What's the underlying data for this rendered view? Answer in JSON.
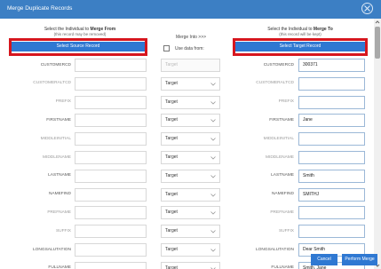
{
  "dialog": {
    "title": "Merge Duplicate Records"
  },
  "left_header": {
    "line1_prefix": "Select the Individual to ",
    "line1_bold": "Merge From",
    "line2": "(this record may be removed)",
    "button": "Select Source Record"
  },
  "middle_header": {
    "merge_into": "Merge Into >>>",
    "use_data_from": "Use data from:"
  },
  "right_header": {
    "line1_prefix": "Select the Individual to ",
    "line1_bold": "Merge To",
    "line2": "(this record will be kept)",
    "button": "Select Target Record"
  },
  "rows": [
    {
      "label": "CUSTOMERCD",
      "choice": "Target",
      "disabled": true,
      "value": "300371"
    },
    {
      "label": "CUSTOMERALTCD",
      "choice": "Target",
      "disabled": false,
      "value": ""
    },
    {
      "label": "PREFIX",
      "choice": "Target",
      "disabled": false,
      "value": ""
    },
    {
      "label": "FIRSTNAME",
      "choice": "Target",
      "disabled": false,
      "value": "Jane"
    },
    {
      "label": "MIDDLEINITIAL",
      "choice": "Target",
      "disabled": false,
      "value": ""
    },
    {
      "label": "MIDDLENAME",
      "choice": "Target",
      "disabled": false,
      "value": ""
    },
    {
      "label": "LASTNAME",
      "choice": "Target",
      "disabled": false,
      "value": "Smith"
    },
    {
      "label": "NAMEFIND",
      "choice": "Target",
      "disabled": false,
      "value": "SMITHJ"
    },
    {
      "label": "PREFNAME",
      "choice": "Target",
      "disabled": false,
      "value": ""
    },
    {
      "label": "SUFFIX",
      "choice": "Target",
      "disabled": false,
      "value": ""
    },
    {
      "label": "LONGSALUTATION",
      "choice": "Target",
      "disabled": false,
      "value": "Dear Smith"
    },
    {
      "label": "FULLNAME",
      "choice": "Target",
      "disabled": false,
      "value": "Smith, Jane"
    }
  ],
  "footer": {
    "cancel": "Cancel",
    "perform_merge": "Perform Merge"
  },
  "colors": {
    "accent": "#2f78d2",
    "titlebar": "#3c7fc4",
    "highlight": "#d6161e"
  }
}
